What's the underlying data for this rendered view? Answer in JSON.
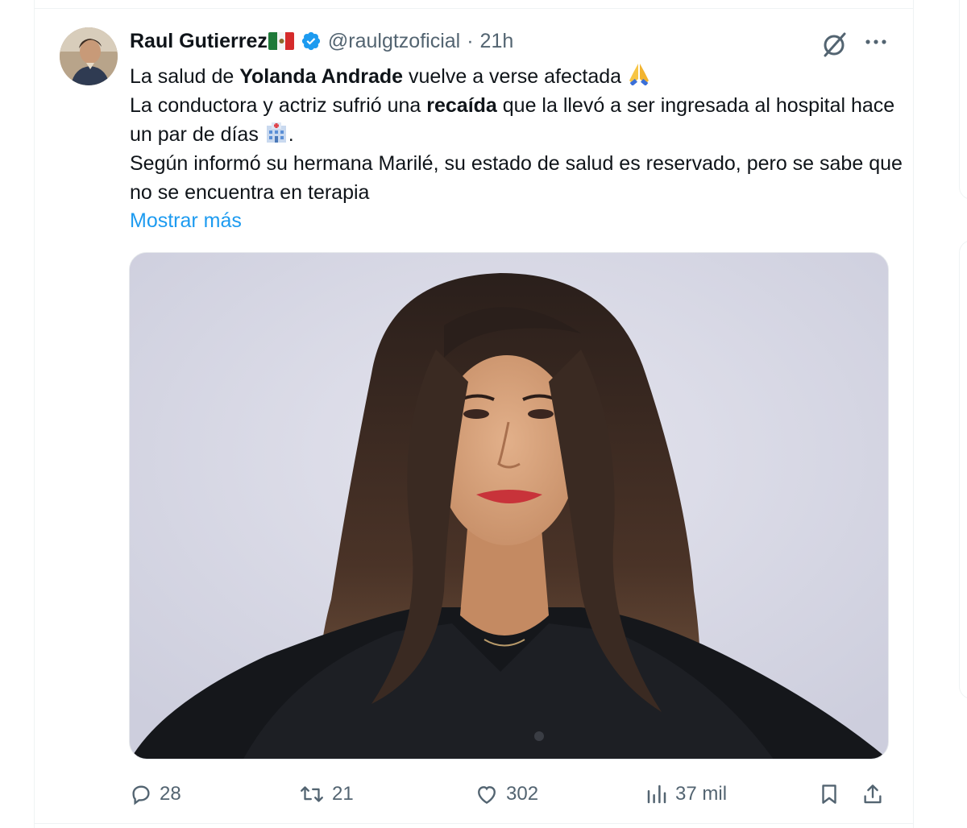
{
  "tweet": {
    "author": {
      "display_name": "Raul Gutierrez",
      "handle": "@raulgtzoficial",
      "verified": true,
      "flag": "mexico-flag"
    },
    "time": "21h",
    "separator": "·",
    "lines": {
      "l1_a": "La salud de ",
      "l1_b": "Yolanda Andrade",
      "l1_c": " vuelve a verse afectada ",
      "l2_a": "La conductora y actriz sufrió una ",
      "l2_b": "recaída",
      "l2_c": " que la llevó a ser ingresada al hospital hace un par de días ",
      "l2_d": ".",
      "l3": "Según informó su hermana Marilé, su estado de salud es reservado, pero se sabe que no se encuentra en terapia"
    },
    "show_more": "Mostrar más",
    "media": {
      "description_icon": "photo-of-woman"
    },
    "stats": {
      "replies": "28",
      "retweets": "21",
      "likes": "302",
      "views": "37 mil"
    }
  },
  "icons": {
    "verified": "verified-badge-icon",
    "grok": "grok-icon",
    "more": "more-icon",
    "reply": "reply-icon",
    "retweet": "retweet-icon",
    "like": "heart-icon",
    "views": "views-icon",
    "bookmark": "bookmark-icon",
    "share": "share-icon"
  },
  "colors": {
    "accent": "#1d9bf0",
    "text": "#0f1419",
    "secondary": "#536471",
    "border": "#eff3f4"
  }
}
